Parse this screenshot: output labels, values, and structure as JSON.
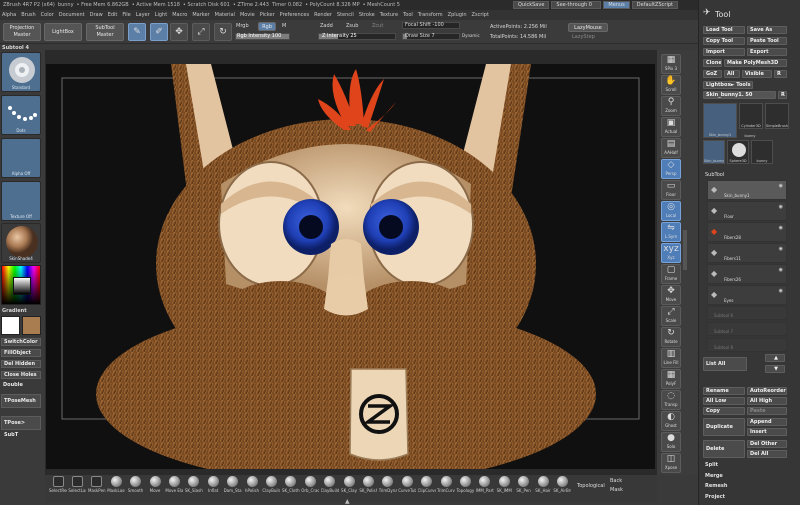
{
  "titlebar": {
    "app": "ZBrush 4R7 P2 (x64)",
    "doc": "bunny",
    "free_mem": "• Free Mem 6.862GB",
    "active_mem": "• Active Mem 1518",
    "scratch": "• Scratch Disk 601",
    "ztime": "• ZTime 2.443",
    "timer": "Timer 0.082",
    "polycount": "• PolyCount 8.326 MP",
    "meshcount": "• MeshCount 5",
    "quicksave": "QuickSave",
    "seethrough": "See-through 0",
    "menus": "Menus",
    "script": "DefaultZScript"
  },
  "menubar": [
    "Alpha",
    "Brush",
    "Color",
    "Document",
    "Draw",
    "Edit",
    "File",
    "Layer",
    "Light",
    "Macro",
    "Marker",
    "Material",
    "Movie",
    "Picker",
    "Preferences",
    "Render",
    "Stencil",
    "Stroke",
    "Texture",
    "Tool",
    "Transform",
    "Zplugin",
    "Zscript"
  ],
  "toprow": {
    "projection_master": "Projection Master",
    "lightbox": "LightBox",
    "subtool_master": "SubTool Master",
    "edit": "Edit",
    "draw": "Draw",
    "move": "Move",
    "scale": "Scale",
    "rotate": "Rotate",
    "mrgb": "Mrgb",
    "rgb": "Rgb",
    "m": "M",
    "zadd": "Zadd",
    "zsub": "Zsub",
    "zcut": "Zcut",
    "focal_shift": "Focal Shift -100",
    "draw_size": "Draw Size 7",
    "dynamic": "Dynamic",
    "rgb_intensity": "Rgb Intensity 100",
    "z_intensity": "Z Intensity 25",
    "active_points": "ActivePoints: 2.256 Mil",
    "total_points": "TotalPoints: 14.586 Mil",
    "lazymouse": "LazyMouse",
    "lazystep": "LazyStep"
  },
  "toprow_values": {
    "rgb_intensity": 100,
    "z_intensity": 25,
    "draw_size": 7
  },
  "leftshelf": {
    "subtool_label": "Subtool 4",
    "brush": "Standard",
    "stroke": "Dots",
    "alpha": "Alpha Off",
    "texture": "Texture Off",
    "material": "SkinShade4",
    "gradient": "Gradient",
    "switch_color": "SwitchColor",
    "fill_object": "FillObject",
    "del_hidden": "Del Hidden",
    "close_holes": "Close Holes",
    "double": "Double",
    "tpose_mesh": "TPoseMesh",
    "tpose_subt": "TPose> SubT"
  },
  "rightshelf": [
    "SPix 3",
    "Scroll",
    "Zoom",
    "Actual",
    "AAHalf",
    "Persp",
    "Floor",
    "Local",
    "L.Sym",
    "Xyz",
    "Frame",
    "Move",
    "Scale",
    "Rotate",
    "Line Fill",
    "PolyF",
    "Transp",
    "Ghost",
    "Solo",
    "Xpose"
  ],
  "bottombar": {
    "items": [
      "SelectRect",
      "SelectLasso",
      "MaskPen",
      "MaskLasso",
      "Smooth",
      "Move",
      "Move Elastic",
      "SK_Slash",
      "Inflat",
      "Dam_Standard",
      "hPolish",
      "ClayBuildup",
      "SK_Cloth",
      "Orb_Cracks",
      "ClayBuildup",
      "SK_Clay",
      "SK_Polish",
      "TrimDynamic",
      "CurveTube",
      "ClipCurve",
      "TrimCurve",
      "Topology",
      "IMM_Parts",
      "SK_IMM",
      "SK_Pen",
      "SK_Hair",
      "SK_AirBrush"
    ],
    "topological": "Topological",
    "back": "Back",
    "mask": "Mask"
  },
  "toolpanel": {
    "title": "Tool",
    "load_tool": "Load Tool",
    "save_as": "Save As",
    "copy_tool": "Copy Tool",
    "paste_tool": "Paste Tool",
    "import": "Import",
    "export": "Export",
    "clone": "Clone",
    "make_polymesh": "Make PolyMesh3D",
    "goz": "GoZ",
    "all": "All",
    "visible": "Visible",
    "r": "R",
    "lightbox_tools": "Lightbox► Tools",
    "current_tool": "Skin_bunny1. 50",
    "r_badge": "R",
    "thumbs": [
      "Skin_bunny1",
      "Cylinder3D",
      "SimpleBrush",
      "bunny",
      "Skin_bunny1",
      "Sphere3D",
      "bunny"
    ],
    "subtool_title": "SubTool",
    "subtools": [
      "Skin_bunny1",
      "Floor",
      "Fibers28",
      "Fibers11",
      "Fibers26",
      "Eyes"
    ],
    "empty_slots": [
      "Subtool 6",
      "Subtool 7",
      "Subtool 8"
    ],
    "list_all": "List All",
    "rename": "Rename",
    "auto_reorder": "AutoReorder",
    "all_low": "All Low",
    "all_high": "All High",
    "copy": "Copy",
    "paste": "Paste",
    "append": "Append",
    "duplicate": "Duplicate",
    "insert": "Insert",
    "delete": "Delete",
    "del_other": "Del Other",
    "del_all": "Del All",
    "split": "Split",
    "merge": "Merge",
    "remesh": "Remesh",
    "project": "Project"
  },
  "colors": {
    "accent": "#5c7fa8",
    "viewport_bg": "#101010",
    "fur": "#7a4a22",
    "muzzle": "#e7c9a3",
    "eye": "#1f3fb5",
    "tuft": "#e0441b"
  },
  "icons": {
    "pointer": "pointer-icon",
    "tool_pen": "tool-pen-icon",
    "sphere": "sphere-icon"
  }
}
